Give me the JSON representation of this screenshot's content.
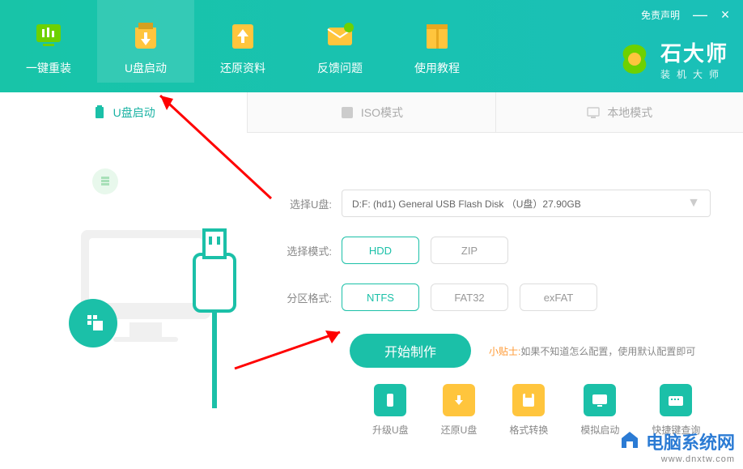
{
  "topbar": {
    "disclaimer": "免责声明",
    "minimize": "—",
    "close": "×"
  },
  "nav": {
    "items": [
      {
        "label": "一键重装"
      },
      {
        "label": "U盘启动"
      },
      {
        "label": "还原资料"
      },
      {
        "label": "反馈问题"
      },
      {
        "label": "使用教程"
      }
    ]
  },
  "brand": {
    "title": "石大师",
    "subtitle": "装机大师"
  },
  "subtabs": {
    "items": [
      {
        "label": "U盘启动"
      },
      {
        "label": "ISO模式"
      },
      {
        "label": "本地模式"
      }
    ]
  },
  "form": {
    "usb_label": "选择U盘:",
    "usb_value": "D:F: (hd1) General USB Flash Disk （U盘）27.90GB",
    "mode_label": "选择模式:",
    "mode_opts": [
      "HDD",
      "ZIP"
    ],
    "fs_label": "分区格式:",
    "fs_opts": [
      "NTFS",
      "FAT32",
      "exFAT"
    ],
    "start": "开始制作",
    "tip_label": "小贴士:",
    "tip_text": "如果不知道怎么配置，使用默认配置即可"
  },
  "tools": {
    "items": [
      {
        "label": "升级U盘"
      },
      {
        "label": "还原U盘"
      },
      {
        "label": "格式转换"
      },
      {
        "label": "模拟启动"
      },
      {
        "label": "快捷键查询"
      }
    ]
  },
  "watermark": {
    "title": "电脑系统网",
    "sub": "www.dnxtw.com"
  }
}
